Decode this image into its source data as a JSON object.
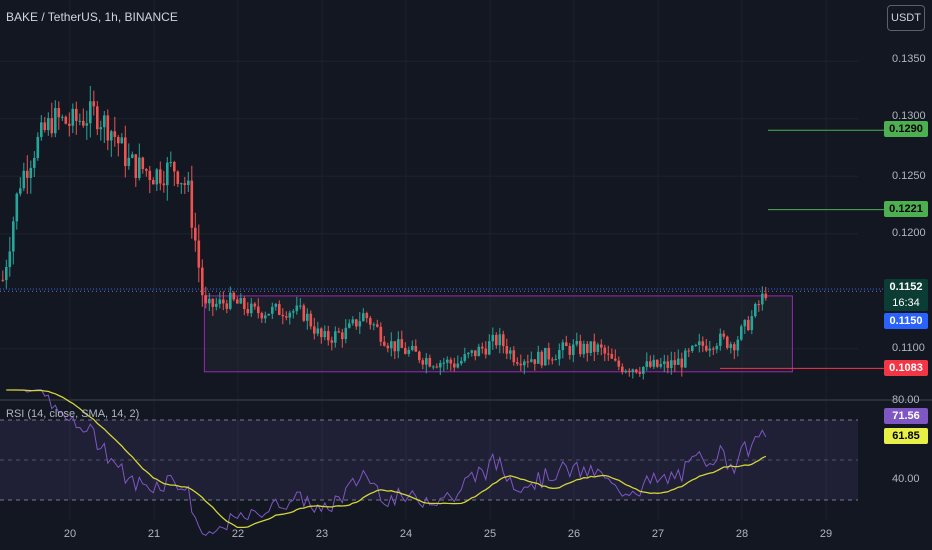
{
  "header": {
    "symbol_title": "BAKE / TetherUS, 1h, BINANCE",
    "currency_button": "USDT"
  },
  "price_axis": {
    "ticks": [
      "0.1350",
      "0.1300",
      "0.1250",
      "0.1200",
      "0.1100"
    ],
    "badges": {
      "target_2": "0.1290",
      "target_1": "0.1221",
      "last_price": "0.1152",
      "countdown": "16:34",
      "level": "0.1150",
      "support": "0.1083"
    }
  },
  "rsi": {
    "label": "RSI (14, close, SMA, 14, 2)",
    "ticks": [
      "80.00",
      "40.00"
    ],
    "badges": {
      "rsi_value": "71.56",
      "rsi_sma": "61.85"
    }
  },
  "time_axis": {
    "ticks": [
      "20",
      "21",
      "22",
      "23",
      "24",
      "25",
      "26",
      "27",
      "28",
      "29"
    ]
  },
  "colors": {
    "background": "#131722",
    "up": "#26a69a",
    "down": "#ef5350",
    "range_box": "#9c27b0",
    "target_line": "#4caf50",
    "support_line": "#f23645",
    "rsi_line": "#7e57c2",
    "rsi_sma": "#d4d43a",
    "current_price_line": "#2962ff"
  },
  "chart_data": {
    "type": "candlestick",
    "price_scale": {
      "min": 0.105,
      "max": 0.138
    },
    "key_levels": {
      "target_2": 0.129,
      "target_1": 0.1221,
      "last_price": 0.1152,
      "level": 0.115,
      "support": 0.1083
    },
    "range_box": {
      "top": 0.1146,
      "bottom": 0.108,
      "start_day": 21.6,
      "end_day": 28.6
    },
    "rsi_last": 71.56,
    "rsi_sma_last": 61.85,
    "path": [
      [
        19.2,
        0.116
      ],
      [
        19.4,
        0.1245
      ],
      [
        19.6,
        0.1278
      ],
      [
        19.8,
        0.13
      ],
      [
        20.0,
        0.1296
      ],
      [
        20.3,
        0.1305
      ],
      [
        20.5,
        0.129
      ],
      [
        20.7,
        0.1262
      ],
      [
        21.0,
        0.1252
      ],
      [
        21.25,
        0.1258
      ],
      [
        21.4,
        0.124
      ],
      [
        21.5,
        0.119
      ],
      [
        21.6,
        0.1135
      ],
      [
        21.9,
        0.1142
      ],
      [
        22.2,
        0.1132
      ],
      [
        22.6,
        0.1134
      ],
      [
        22.8,
        0.113
      ],
      [
        23.0,
        0.1108
      ],
      [
        23.3,
        0.1115
      ],
      [
        23.5,
        0.113
      ],
      [
        23.8,
        0.1105
      ],
      [
        24.0,
        0.1098
      ],
      [
        24.3,
        0.109
      ],
      [
        24.6,
        0.1087
      ],
      [
        24.9,
        0.11
      ],
      [
        25.1,
        0.1108
      ],
      [
        25.3,
        0.1093
      ],
      [
        25.6,
        0.1092
      ],
      [
        25.9,
        0.11
      ],
      [
        26.1,
        0.11
      ],
      [
        26.3,
        0.11
      ],
      [
        26.5,
        0.1085
      ],
      [
        26.8,
        0.1084
      ],
      [
        27.1,
        0.1085
      ],
      [
        27.3,
        0.109
      ],
      [
        27.5,
        0.1102
      ],
      [
        27.7,
        0.1108
      ],
      [
        27.9,
        0.1105
      ],
      [
        28.1,
        0.1125
      ],
      [
        28.3,
        0.1152
      ]
    ]
  }
}
